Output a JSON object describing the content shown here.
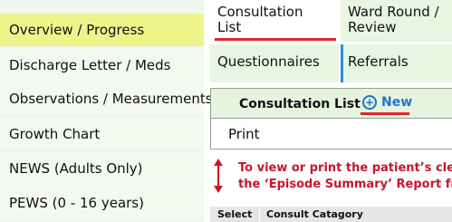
{
  "sidebar": {
    "items": [
      {
        "label": "Overview / Progress",
        "active": true
      },
      {
        "label": "Discharge Letter / Meds"
      },
      {
        "label": "Observations / Measurements"
      },
      {
        "label": "Growth Chart"
      },
      {
        "label": "NEWS (Adults Only)"
      },
      {
        "label": "PEWS (0 - 16 years)"
      }
    ]
  },
  "tabs": {
    "consultation_line1": "Consultation",
    "consultation_line2": "List",
    "ward_round_line1": "Ward Round /",
    "ward_round_line2": "Review",
    "questionnaires": "Questionnaires",
    "referrals": "Referrals"
  },
  "panel": {
    "title": "Consultation List",
    "new_label": "New",
    "print_label": "Print"
  },
  "note": {
    "line1": "To view or print the patient’s cler",
    "line2": "the ‘Episode Summary’ Report fr"
  },
  "table": {
    "headers": [
      "Select",
      "Consult Catagory"
    ]
  },
  "colors": {
    "active_sidebar": "#eef48a",
    "tab_bg": "#e9f5e3",
    "accent_red": "#e0242b",
    "link_blue": "#1c77c7",
    "note_red": "#c8152a"
  }
}
